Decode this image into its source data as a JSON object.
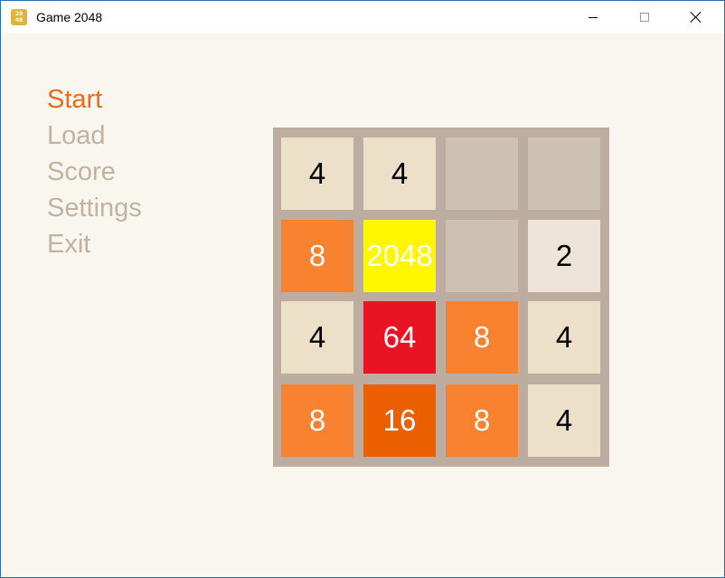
{
  "window": {
    "title": "Game 2048",
    "icon_text": "2048",
    "icon_name": "app-2048-icon"
  },
  "menu": {
    "items": [
      {
        "label": "Start",
        "active": true
      },
      {
        "label": "Load",
        "active": false
      },
      {
        "label": "Score",
        "active": false
      },
      {
        "label": "Settings",
        "active": false
      },
      {
        "label": "Exit",
        "active": false
      }
    ],
    "active_color": "#eb6b16",
    "inactive_color": "#c1b3a4"
  },
  "board": {
    "background": "#bcada0",
    "grid": [
      [
        4,
        4,
        null,
        null
      ],
      [
        8,
        2048,
        null,
        2
      ],
      [
        4,
        64,
        8,
        4
      ],
      [
        8,
        16,
        8,
        4
      ]
    ],
    "tile_styles": {
      "empty": {
        "bg": "#cdc1b4",
        "fg": "#000000"
      },
      "2": {
        "bg": "#eee4da",
        "fg": "#000000"
      },
      "4": {
        "bg": "#ede0c8",
        "fg": "#000000"
      },
      "8": {
        "bg": "#f88230",
        "fg": "#ffffff"
      },
      "16": {
        "bg": "#ea6000",
        "fg": "#ffffff"
      },
      "64": {
        "bg": "#e81424",
        "fg": "#ffffff"
      },
      "2048": {
        "bg": "#fff700",
        "fg": "#ffffff"
      }
    }
  }
}
